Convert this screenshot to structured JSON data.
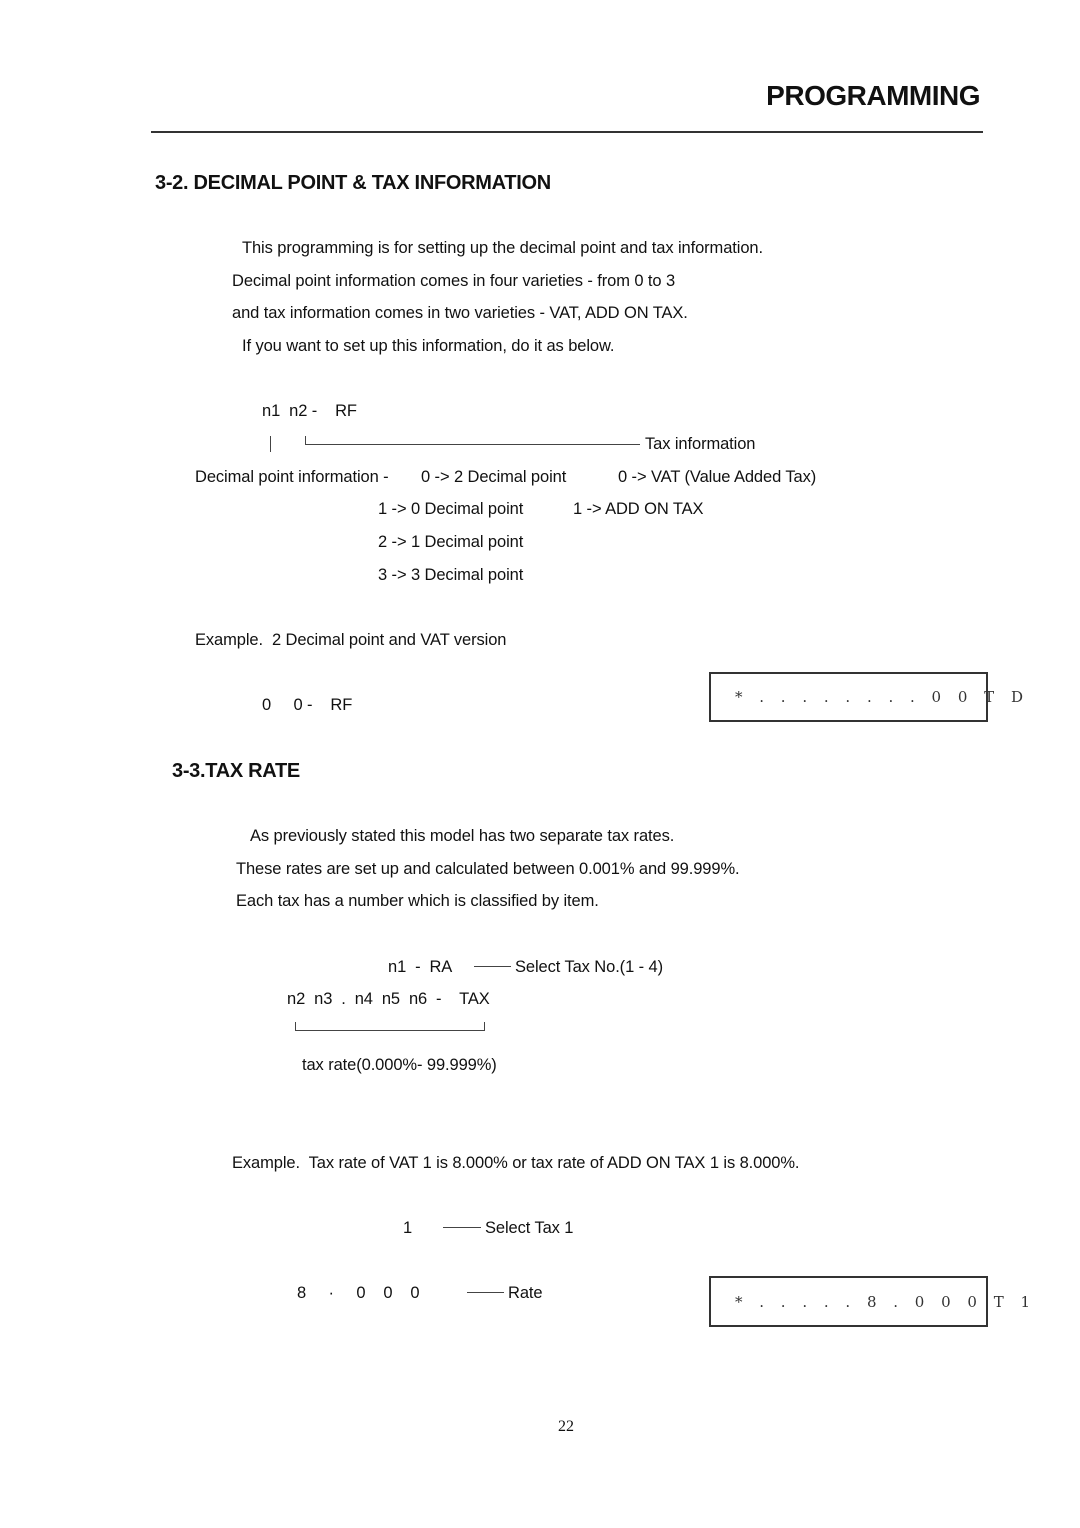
{
  "header": {
    "title": "PROGRAMMING"
  },
  "section_decimal": {
    "heading": "3-2. DECIMAL POINT & TAX INFORMATION",
    "paragraph": [
      "This programming is for setting up the decimal point and tax information.",
      "Decimal point information comes in four varieties - from 0 to 3",
      "and tax information comes in two varieties - VAT, ADD ON TAX.",
      "If you want to set up this information, do it as below."
    ],
    "diagram": {
      "key_sequence": "n1  n2 -    RF",
      "tax_info_label": "Tax information",
      "decimal_label": "Decimal point information -",
      "decimal_options": [
        "0 -> 2 Decimal point",
        "1 -> 0 Decimal point",
        "2 -> 1 Decimal point",
        "3 -> 3 Decimal point"
      ],
      "tax_options": [
        "0 -> VAT (Value Added Tax)",
        "1 -> ADD ON TAX"
      ]
    },
    "example": {
      "caption": "Example.  2 Decimal point and VAT version",
      "keys": "0     0 -    RF",
      "display": "* . . . . . . . . 0 0 T D"
    }
  },
  "section_taxrate": {
    "heading": "3-3.TAX RATE",
    "paragraph": [
      "As previously stated this model has two separate tax rates.",
      "These rates are set up and calculated between 0.001% and 99.999%.",
      "Each tax has a number which is classified by item."
    ],
    "diagram": {
      "select_keys": "n1  -  RA",
      "select_label": "Select Tax No.(1 - 4)",
      "rate_keys": "n2  n3  .  n4  n5  n6  -    TAX",
      "rate_label": "tax rate(0.000%- 99.999%)"
    },
    "example": {
      "caption": "Example.  Tax rate of VAT 1 is 8.000% or tax rate of ADD ON TAX 1 is 8.000%.",
      "select_key": "1",
      "select_label": "Select Tax 1",
      "rate_keys": "8     ·     0    0    0",
      "rate_label": "Rate",
      "display": "* . . . . . 8 . 0 0 0 T 1"
    }
  },
  "footer": {
    "page_number": "22"
  }
}
